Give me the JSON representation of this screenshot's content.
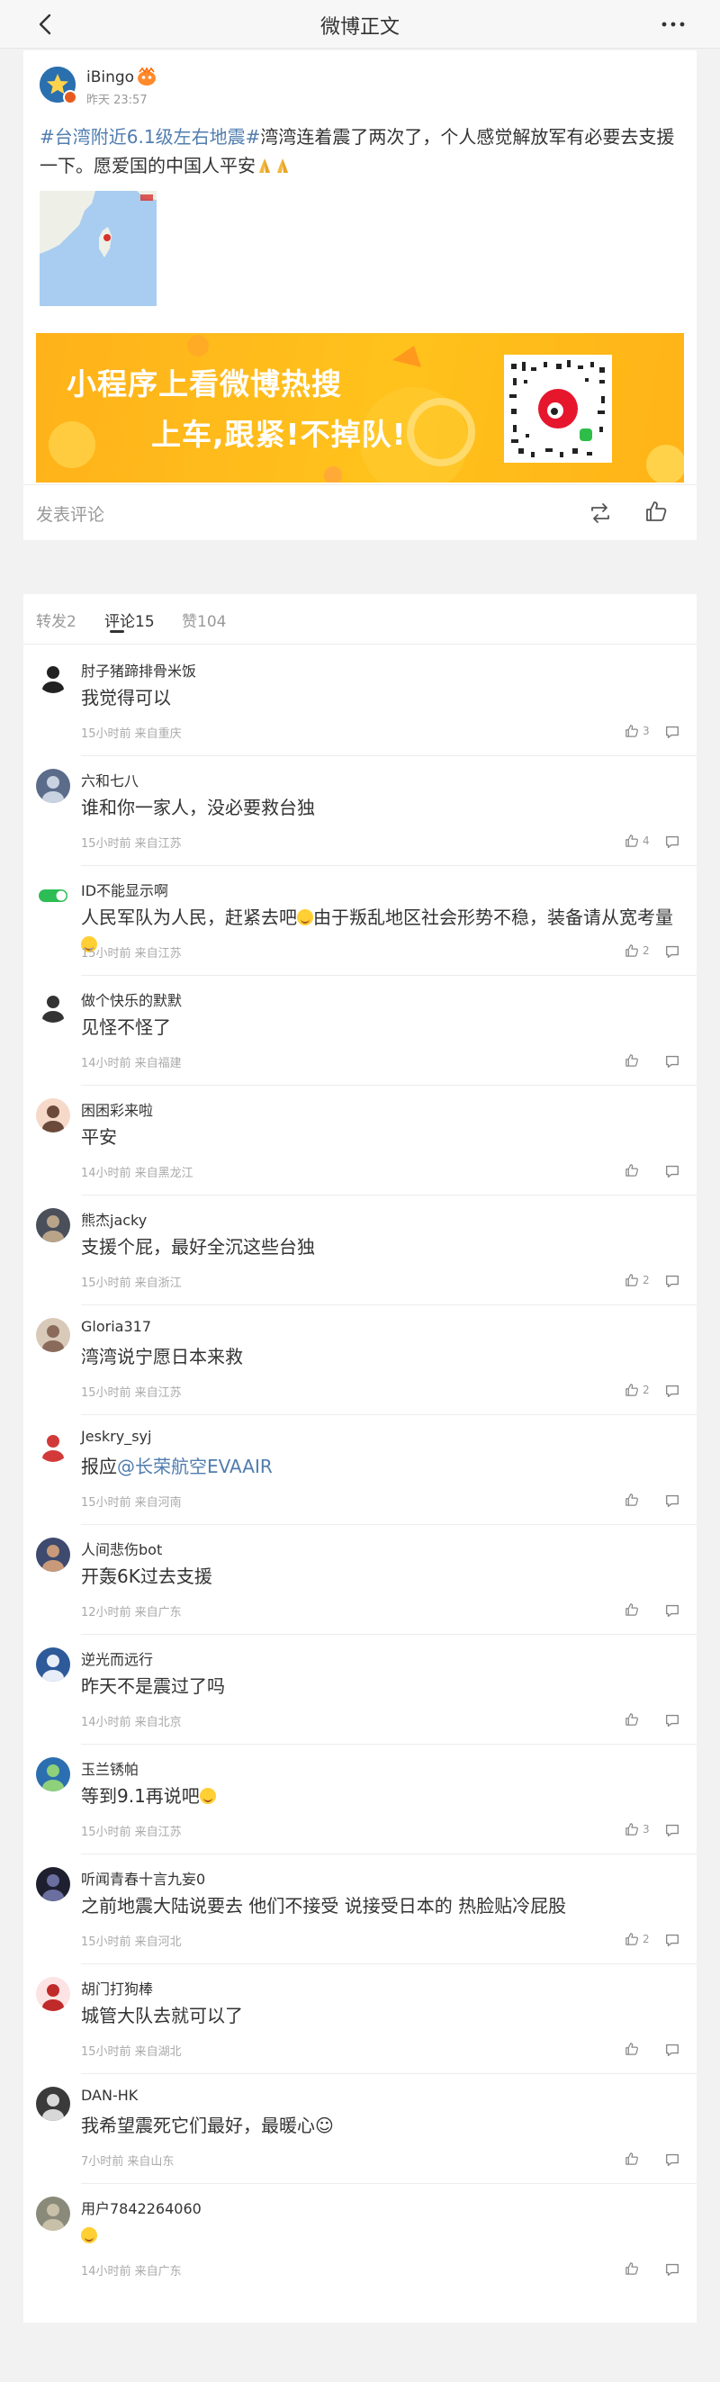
{
  "header": {
    "title": "微博正文"
  },
  "post": {
    "username": "iBingo",
    "time": "昨天 23:57",
    "topic": "#台湾附近6.1级左右地震#",
    "text": "湾湾连着震了两次了，个人感觉解放军有必要去支援一下。愿爱国的中国人平安",
    "banner": {
      "line1": "小程序上看微博热搜",
      "line2": "上车,跟紧!不掉队!"
    },
    "compose_placeholder": "发表评论"
  },
  "tabs": [
    {
      "label": "转发2"
    },
    {
      "label": "评论15"
    },
    {
      "label": "赞104"
    }
  ],
  "comments": [
    {
      "name": "肘子猪蹄排骨米饭",
      "text": "我觉得可以",
      "meta": "15小时前 来自重庆",
      "likes": "3"
    },
    {
      "name": "六和七八",
      "text": "谁和你一家人，没必要救台独",
      "meta": "15小时前 来自江苏",
      "likes": "4"
    },
    {
      "name": "ID不能显示啊",
      "text": "人民军队为人民，赶紧去吧",
      "text2": "由于叛乱地区社会形势不稳，装备请从宽考量",
      "meta": "15小时前 来自江苏",
      "likes": "2"
    },
    {
      "name": "做个快乐的默默",
      "text": "见怪不怪了",
      "meta": "14小时前 来自福建",
      "likes": ""
    },
    {
      "name": "困困彩来啦",
      "text": "平安",
      "meta": "14小时前 来自黑龙江",
      "likes": ""
    },
    {
      "name": "熊杰jacky",
      "text": "支援个屁，最好全沉这些台独",
      "meta": "15小时前 来自浙江",
      "likes": "2"
    },
    {
      "name": "Gloria317",
      "text": "湾湾说宁愿日本来救",
      "meta": "15小时前 来自江苏",
      "likes": "2"
    },
    {
      "name": "Jeskry_syj",
      "text": "报应",
      "mention": "@长荣航空EVAAIR",
      "meta": "15小时前 来自河南",
      "likes": ""
    },
    {
      "name": "人间悲伤bot",
      "text": "开轰6K过去支援",
      "meta": "12小时前 来自广东",
      "likes": ""
    },
    {
      "name": "逆光而远行",
      "text": "昨天不是震过了吗",
      "meta": "14小时前 来自北京",
      "likes": ""
    },
    {
      "name": "玉兰锈帕",
      "text": "等到9.1再说吧",
      "meta": "15小时前 来自江苏",
      "likes": "3"
    },
    {
      "name": "听闻青春十言九妄0",
      "text": "之前地震大陆说要去 他们不接受 说接受日本的 热脸贴冷屁股",
      "meta": "15小时前 来自河北",
      "likes": "2"
    },
    {
      "name": "胡门打狗棒",
      "text": "城管大队去就可以了",
      "meta": "15小时前 来自湖北",
      "likes": ""
    },
    {
      "name": "DAN-HK",
      "text": "我希望震死它们最好，最暖心☺",
      "meta": "7小时前 来自山东",
      "likes": ""
    },
    {
      "name": "用户7842264060",
      "text": "",
      "meta": "14小时前 来自广东",
      "likes": ""
    }
  ],
  "colors": {
    "link": "#507daf",
    "banner": "#ffb21a",
    "background": "#f2f2f2"
  }
}
